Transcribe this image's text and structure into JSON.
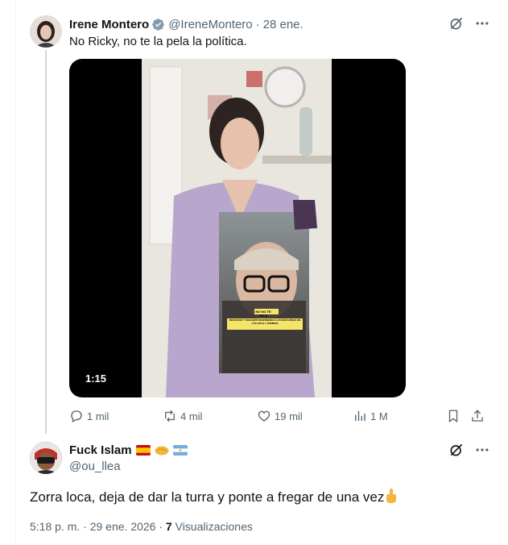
{
  "parent_tweet": {
    "display_name": "Irene Montero",
    "handle": "@IreneMontero",
    "separator": "·",
    "date": "28 ene.",
    "text": "No Ricky, no te la pela la política.",
    "video": {
      "duration": "1:15",
      "overlay_caption": "NO NO TE PELA",
      "overlay_subcaption": "ROSCOSEY Y DESANPP RESPONDEN A LOS DISCURSOS EN LOS GOYA Y PREMIOS"
    },
    "actions": {
      "replies": "1 mil",
      "reposts": "4 mil",
      "likes": "19 mil",
      "views": "1 M"
    }
  },
  "reply_tweet": {
    "display_name": "Fuck Islam",
    "handle": "@ou_llea",
    "text": "Zorra loca, deja de dar la turra y ponte a fregar de una vez",
    "time": "5:18 p. m.",
    "separator": "·",
    "date": "29 ene. 2026",
    "views_count": "7",
    "views_label": "Visualizaciones"
  },
  "colors": {
    "text_primary": "#0f1419",
    "text_secondary": "#536471",
    "verified_blue": "#829aab",
    "border": "#eff3f4"
  },
  "icons": [
    "grok-icon",
    "more-icon",
    "reply-icon",
    "repost-icon",
    "like-icon",
    "views-icon",
    "bookmark-icon",
    "share-icon",
    "verified-badge-icon",
    "spain-flag-icon",
    "handshake-icon",
    "argentina-flag-icon",
    "middle-finger-icon"
  ]
}
